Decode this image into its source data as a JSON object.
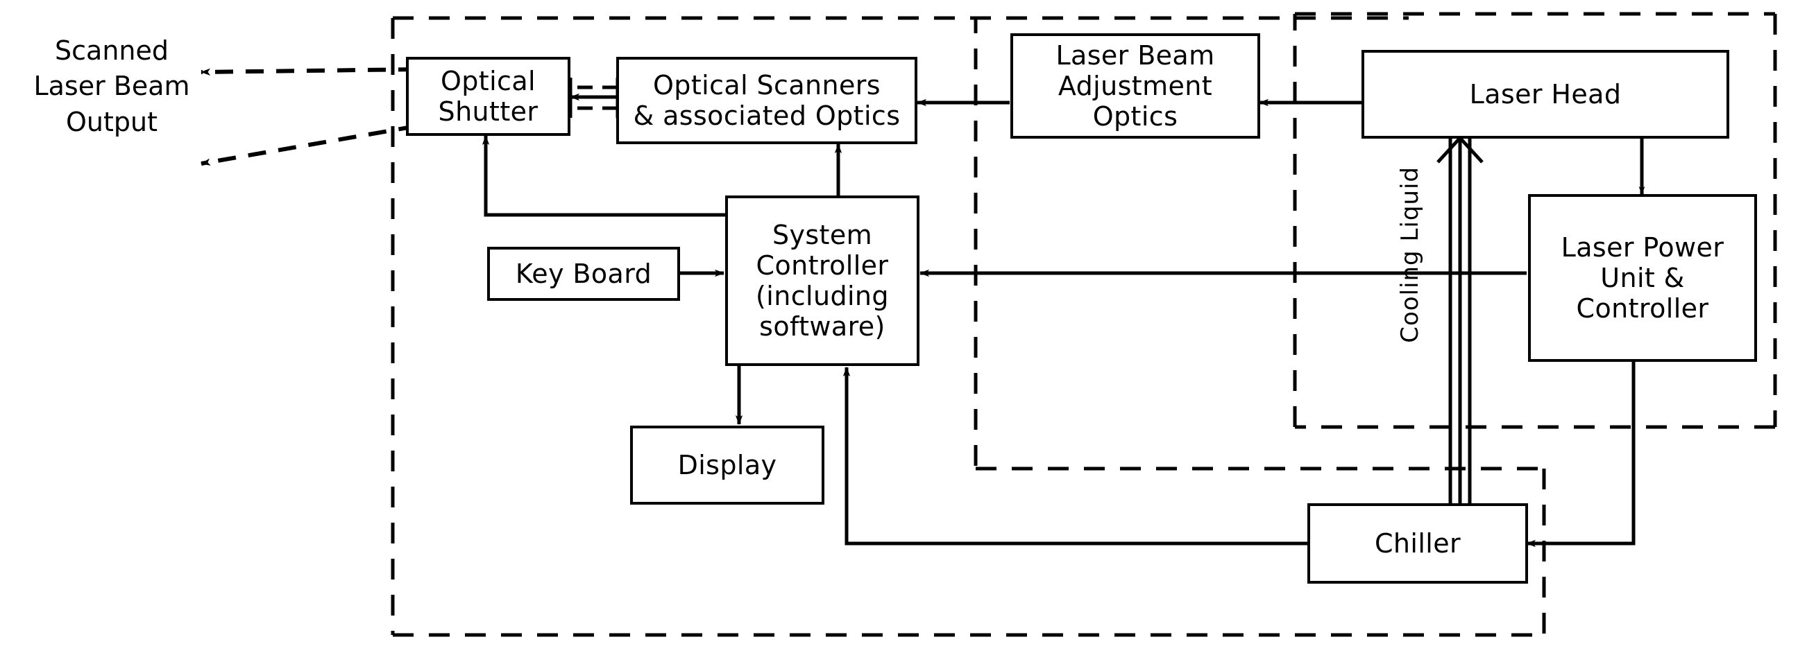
{
  "diagram": {
    "title": "Laser scanning system block diagram",
    "type": "block-diagram",
    "stroke_color": "#000000",
    "background_color": "#ffffff"
  },
  "labels": {
    "scanned_output": "Scanned\nLaser Beam\nOutput",
    "cooling_liquid": "Cooling Liquid"
  },
  "nodes": [
    {
      "id": "optical-shutter",
      "text": "Optical\nShutter"
    },
    {
      "id": "optical-scanners",
      "text": "Optical Scanners\n& associated Optics"
    },
    {
      "id": "beam-adjust",
      "text": "Laser Beam\nAdjustment\nOptics"
    },
    {
      "id": "laser-head",
      "text": "Laser Head"
    },
    {
      "id": "system-controller",
      "text": "System\nController\n(including\nsoftware)"
    },
    {
      "id": "key-board",
      "text": "Key Board"
    },
    {
      "id": "display",
      "text": "Display"
    },
    {
      "id": "laser-power",
      "text": "Laser Power\nUnit &\nController"
    },
    {
      "id": "chiller",
      "text": "Chiller"
    }
  ],
  "enclosures": [
    {
      "id": "scanner-enclosure",
      "style": "dashed"
    },
    {
      "id": "laser-enclosure",
      "style": "dashed"
    },
    {
      "id": "chiller-enclosure",
      "style": "dashed"
    }
  ],
  "connections": [
    {
      "from": "optical-shutter",
      "to": "scanned-output-upper",
      "style": "dashed",
      "arrow": "single"
    },
    {
      "from": "optical-shutter",
      "to": "scanned-output-lower",
      "style": "dashed",
      "arrow": "single"
    },
    {
      "from": "optical-scanners",
      "to": "optical-shutter",
      "style": "beam",
      "arrow": "single"
    },
    {
      "from": "beam-adjust",
      "to": "optical-scanners",
      "style": "solid",
      "arrow": "single"
    },
    {
      "from": "laser-head",
      "to": "beam-adjust",
      "style": "solid",
      "arrow": "single"
    },
    {
      "from": "system-controller",
      "to": "optical-shutter",
      "style": "solid",
      "arrow": "single"
    },
    {
      "from": "system-controller",
      "to": "optical-scanners",
      "style": "solid",
      "arrow": "single"
    },
    {
      "from": "key-board",
      "to": "system-controller",
      "style": "solid",
      "arrow": "single"
    },
    {
      "from": "system-controller",
      "to": "display",
      "style": "solid",
      "arrow": "single"
    },
    {
      "from": "laser-power",
      "to": "system-controller",
      "style": "solid",
      "arrow": "single"
    },
    {
      "from": "laser-power",
      "to": "laser-head",
      "style": "solid",
      "arrow": "double"
    },
    {
      "from": "chiller",
      "to": "laser-head",
      "style": "pipe",
      "arrow": "single",
      "label": "Cooling Liquid"
    },
    {
      "from": "chiller",
      "to": "system-controller",
      "style": "solid",
      "arrow": "single"
    },
    {
      "from": "laser-power",
      "to": "chiller",
      "style": "solid",
      "arrow": "single"
    }
  ]
}
